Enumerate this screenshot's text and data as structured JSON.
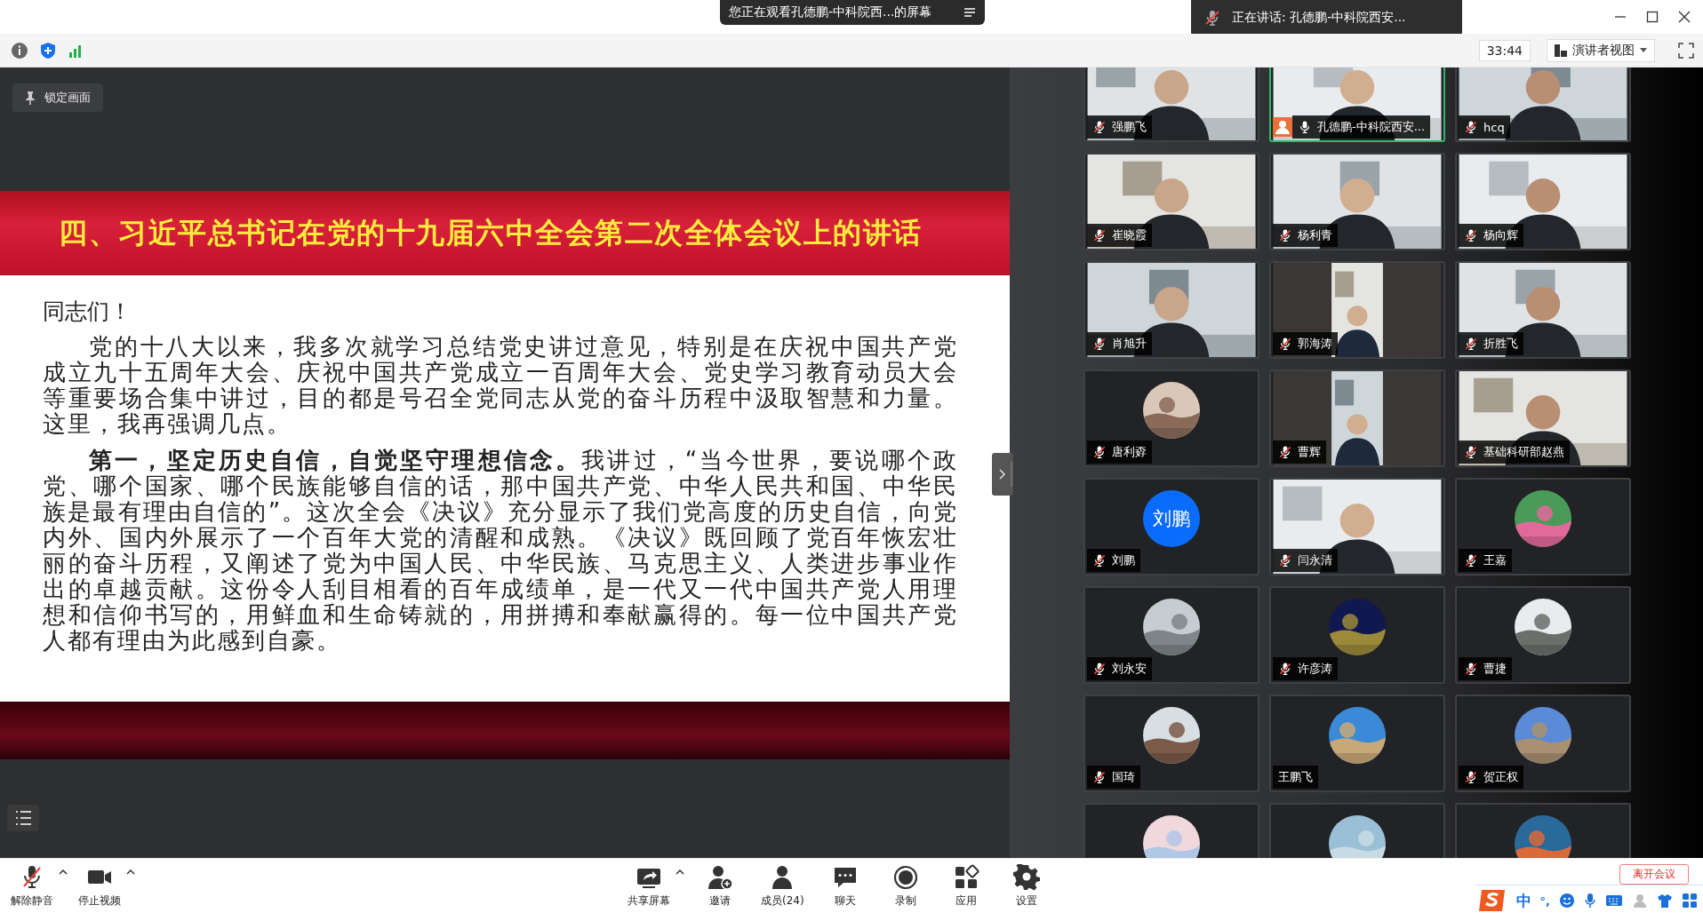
{
  "title_bar": {
    "sharing_banner": "您正在观看孔德鹏-中科院西...的屏幕",
    "speaking_notice": "正在讲话: 孔德鹏-中科院西安..."
  },
  "info_bar": {
    "timer": "33:44",
    "view_button": "演讲者视图"
  },
  "shared_screen": {
    "lock_button": "锁定画面",
    "slide": {
      "title": "四、习近平总书记在党的十九届六中全会第二次全体会议上的讲话",
      "greeting": "同志们！",
      "paragraphs": [
        "党的十八大以来，我多次就学习总结党史讲过意见，特别是在庆祝中国共产党成立九十五周年大会、庆祝中国共产党成立一百周年大会、党史学习教育动员大会等重要场合集中讲过，目的都是号召全党同志从党的奋斗历程中汲取智慧和力量。这里，我再强调几点。",
        "**第一，坚定历史自信，自觉坚守理想信念。**我讲过，“当今世界，要说哪个政党、哪个国家、哪个民族能够自信的话，那中国共产党、中华人民共和国、中华民族是最有理由自信的”。这次全会《决议》充分显示了我们党高度的历史自信，向党内外、国内外展示了一个百年大党的清醒和成熟。《决议》既回顾了党百年恢宏壮丽的奋斗历程，又阐述了党为中国人民、中华民族、马克思主义、人类进步事业作出的卓越贡献。这份令人刮目相看的百年成绩单，是一代又一代中国共产党人用理想和信仰书写的，用鲜血和生命铸就的，用拼搏和奉献赢得的。每一位中国共产党人都有理由为此感到自豪。"
      ]
    }
  },
  "participants": [
    {
      "name": "强鹏飞",
      "kind": "video",
      "mic_icon": true,
      "muted": true,
      "speaking": false,
      "person_icon": false
    },
    {
      "name": "孔德鹏-中科院西安...",
      "kind": "video",
      "mic_icon": true,
      "muted": false,
      "speaking": true,
      "person_icon": true
    },
    {
      "name": "hcq",
      "kind": "video",
      "mic_icon": true,
      "muted": true,
      "speaking": false,
      "person_icon": false
    },
    {
      "name": "崔晓霞",
      "kind": "video",
      "mic_icon": true,
      "muted": true,
      "speaking": false,
      "person_icon": false
    },
    {
      "name": "杨利青",
      "kind": "video",
      "mic_icon": true,
      "muted": true,
      "speaking": false,
      "person_icon": false
    },
    {
      "name": "杨向辉",
      "kind": "video",
      "mic_icon": true,
      "muted": true,
      "speaking": false,
      "person_icon": false
    },
    {
      "name": "肖旭升",
      "kind": "video",
      "mic_icon": true,
      "muted": true,
      "speaking": false,
      "person_icon": false
    },
    {
      "name": "郭海涛",
      "kind": "portrait_video",
      "mic_icon": true,
      "muted": true,
      "speaking": false,
      "person_icon": false
    },
    {
      "name": "折胜飞",
      "kind": "video",
      "mic_icon": true,
      "muted": true,
      "speaking": false,
      "person_icon": false
    },
    {
      "name": "唐利孬",
      "kind": "avatar",
      "mic_icon": true,
      "muted": true,
      "speaking": false,
      "person_icon": false
    },
    {
      "name": "曹辉",
      "kind": "portrait_video",
      "mic_icon": true,
      "muted": true,
      "speaking": false,
      "person_icon": false
    },
    {
      "name": "基础科研部赵燕",
      "kind": "video",
      "mic_icon": true,
      "muted": true,
      "speaking": false,
      "person_icon": false
    },
    {
      "name": "刘鹏",
      "kind": "initials",
      "initials": "刘鹏",
      "mic_icon": true,
      "muted": true,
      "speaking": false,
      "person_icon": false
    },
    {
      "name": "闫永清",
      "kind": "video",
      "mic_icon": true,
      "muted": true,
      "speaking": false,
      "person_icon": false
    },
    {
      "name": "王嘉",
      "kind": "avatar",
      "mic_icon": true,
      "muted": true,
      "speaking": false,
      "person_icon": false
    },
    {
      "name": "刘永安",
      "kind": "avatar",
      "mic_icon": true,
      "muted": true,
      "speaking": false,
      "person_icon": false
    },
    {
      "name": "许彦涛",
      "kind": "avatar",
      "mic_icon": true,
      "muted": true,
      "speaking": false,
      "person_icon": false
    },
    {
      "name": "曹捷",
      "kind": "avatar",
      "mic_icon": true,
      "muted": true,
      "speaking": false,
      "person_icon": false
    },
    {
      "name": "国琦",
      "kind": "avatar",
      "mic_icon": true,
      "muted": true,
      "speaking": false,
      "person_icon": false
    },
    {
      "name": "王鹏飞",
      "kind": "avatar",
      "mic_icon": false,
      "speaking": false,
      "person_icon": false
    },
    {
      "name": "贺正权",
      "kind": "avatar",
      "mic_icon": true,
      "muted": true,
      "speaking": false,
      "person_icon": false
    },
    {
      "kind": "avatar",
      "speaking": false
    },
    {
      "kind": "avatar",
      "speaking": false
    },
    {
      "kind": "avatar",
      "speaking": false
    }
  ],
  "toolbar": {
    "left": [
      {
        "label": "解除静音",
        "kind": "mic_muted",
        "menu": true
      },
      {
        "label": "停止视频",
        "kind": "camera",
        "menu": true
      }
    ],
    "center": [
      {
        "label": "共享屏幕",
        "kind": "share",
        "menu": true
      },
      {
        "label": "邀请",
        "kind": "invite",
        "menu": false
      },
      {
        "label": "成员(24)",
        "kind": "members",
        "menu": false
      },
      {
        "label": "聊天",
        "kind": "chat",
        "menu": false
      },
      {
        "label": "录制",
        "kind": "record",
        "menu": false
      },
      {
        "label": "应用",
        "kind": "apps",
        "menu": false
      },
      {
        "label": "设置",
        "kind": "settings",
        "menu": false
      }
    ],
    "leave_button": "离开会议"
  },
  "ime_bar": {
    "mode": "中",
    "punctuation": "°,"
  }
}
